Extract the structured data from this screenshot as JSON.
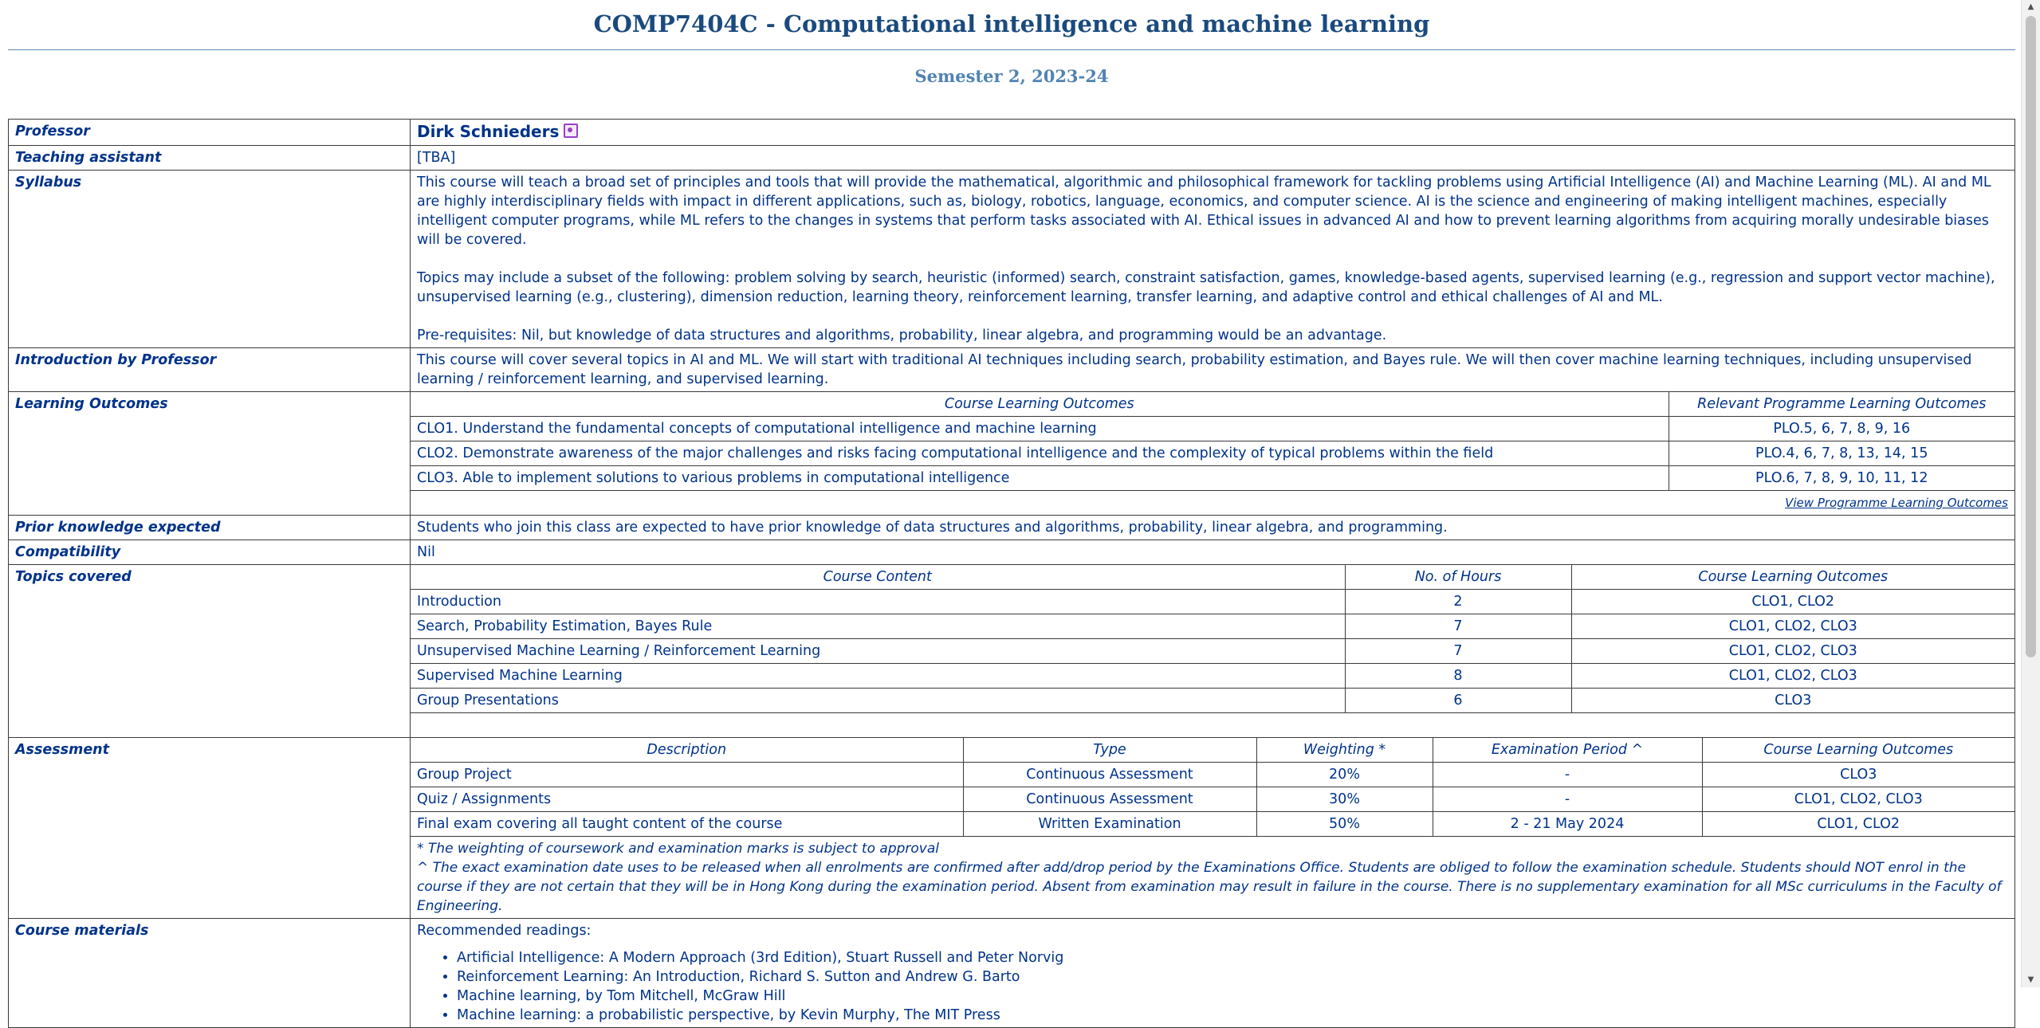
{
  "course": {
    "title": "COMP7404C - Computational intelligence and machine learning",
    "semester": "Semester 2, 2023-24"
  },
  "labels": {
    "professor": "Professor",
    "teaching_assistant": "Teaching assistant",
    "syllabus": "Syllabus",
    "introduction": "Introduction by Professor",
    "learning_outcomes": "Learning Outcomes",
    "prior_knowledge": "Prior knowledge expected",
    "compatibility": "Compatibility",
    "topics": "Topics covered",
    "assessment": "Assessment",
    "materials": "Course materials"
  },
  "professor": {
    "name": "Dirk Schnieders",
    "icon": "profile-icon"
  },
  "teaching_assistant": "[TBA]",
  "syllabus": {
    "p1": "This course will teach a broad set of principles and tools that will provide the mathematical, algorithmic and philosophical framework for tackling problems using Artificial Intelligence (AI) and Machine Learning (ML). AI and ML are highly interdisciplinary fields with impact in different applications, such as, biology, robotics, language, economics, and computer science. AI is the science and engineering of making intelligent machines, especially intelligent computer programs, while ML refers to the changes in systems that perform tasks associated with AI. Ethical issues in advanced AI and how to prevent learning algorithms from acquiring morally undesirable biases will be covered.",
    "p2": "Topics may include a subset of the following: problem solving by search, heuristic (informed) search, constraint satisfaction, games, knowledge-based agents, supervised learning (e.g., regression and support vector machine), unsupervised learning (e.g., clustering), dimension reduction, learning theory, reinforcement learning, transfer learning, and adaptive control and ethical challenges of AI and ML.",
    "p3": "Pre-requisites: Nil, but knowledge of data structures and algorithms, probability, linear algebra, and programming would be an advantage."
  },
  "introduction": "This course will cover several topics in AI and ML.  We will start with traditional AI techniques including search, probability estimation, and Bayes rule.  We will then cover machine learning techniques, including unsupervised learning / reinforcement learning, and supervised learning.",
  "learning_outcomes": {
    "headers": [
      "Course Learning Outcomes",
      "Relevant Programme Learning Outcomes"
    ],
    "rows": [
      [
        "CLO1. Understand the fundamental concepts of computational intelligence and machine learning",
        "PLO.5, 6, 7, 8, 9, 16"
      ],
      [
        "CLO2. Demonstrate awareness of the major challenges and risks facing computational intelligence and the complexity of typical problems within the field",
        "PLO.4, 6, 7, 8, 13, 14, 15"
      ],
      [
        "CLO3. Able to implement solutions to various problems in computational intelligence",
        "PLO.6, 7, 8, 9, 10, 11, 12"
      ]
    ],
    "link": "View Programme Learning Outcomes"
  },
  "prior_knowledge": "Students who join this class are expected to have prior knowledge of data structures and algorithms, probability, linear algebra, and programming.",
  "compatibility": "Nil",
  "topics": {
    "headers": [
      "Course Content",
      "No. of Hours",
      "Course Learning Outcomes"
    ],
    "rows": [
      [
        "Introduction",
        "2",
        "CLO1, CLO2"
      ],
      [
        "Search, Probability Estimation, Bayes Rule",
        "7",
        "CLO1, CLO2, CLO3"
      ],
      [
        "Unsupervised Machine Learning / Reinforcement Learning",
        "7",
        "CLO1, CLO2, CLO3"
      ],
      [
        "Supervised Machine Learning",
        "8",
        "CLO1, CLO2, CLO3"
      ],
      [
        "Group Presentations",
        "6",
        "CLO3"
      ]
    ]
  },
  "assessment": {
    "headers": [
      "Description",
      "Type",
      "Weighting *",
      "Examination Period ^",
      "Course Learning Outcomes"
    ],
    "rows": [
      [
        "Group Project",
        "Continuous Assessment",
        "20%",
        "-",
        "CLO3"
      ],
      [
        "Quiz / Assignments",
        "Continuous Assessment",
        "30%",
        "-",
        "CLO1, CLO2, CLO3"
      ],
      [
        "Final exam covering all taught content of the course",
        "Written Examination",
        "50%",
        "2 - 21 May 2024",
        "CLO1, CLO2"
      ]
    ],
    "note1": "* The weighting of coursework and examination marks is subject to approval",
    "note2": "^ The exact examination date uses to be released when all enrolments are confirmed after add/drop period by the Examinations Office.  Students are obliged to follow the examination schedule.  Students should NOT enrol in the course if they are not certain that they will be in Hong Kong during the examination period.  Absent from examination may result in failure in the course. There is no supplementary examination for all MSc curriculums in the Faculty of Engineering."
  },
  "materials": {
    "intro": "Recommended readings:",
    "readings": [
      "Artificial Intelligence: A Modern Approach (3rd Edition), Stuart Russell and Peter Norvig",
      "Reinforcement Learning: An Introduction, Richard S. Sutton and Andrew G. Barto",
      "Machine learning, by Tom Mitchell, McGraw Hill",
      "Machine learning: a probabilistic perspective, by Kevin Murphy, The MIT Press"
    ]
  }
}
